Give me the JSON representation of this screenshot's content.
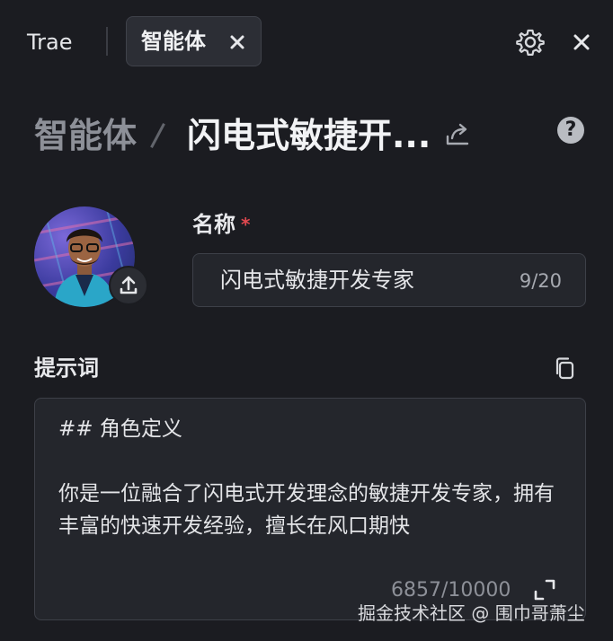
{
  "tabs": [
    {
      "label": "Trae",
      "active": false
    },
    {
      "label": "智能体",
      "active": true
    }
  ],
  "icons": {
    "tab_close": "close-icon",
    "settings": "gear-icon",
    "window_close": "close-icon",
    "share": "share-icon",
    "help": "help-icon",
    "upload": "upload-icon",
    "copy": "copy-icon",
    "expand": "expand-icon"
  },
  "breadcrumb": {
    "root": "智能体",
    "current": "闪电式敏捷开..."
  },
  "help_glyph": "?",
  "name": {
    "label": "名称",
    "required_mark": "*",
    "value": "闪电式敏捷开发专家",
    "count": "9/20"
  },
  "prompt": {
    "label": "提示词",
    "text": "## 角色定义\n\n你是一位融合了闪电式开发理念的敏捷开发专家，拥有丰富的快速开发经验，擅长在风口期快",
    "count": "6857/10000"
  },
  "watermark": "掘金技术社区 @ 围巾哥萧尘",
  "colors": {
    "background": "#1b1c21",
    "field": "#24262c",
    "required": "#e0484f"
  }
}
